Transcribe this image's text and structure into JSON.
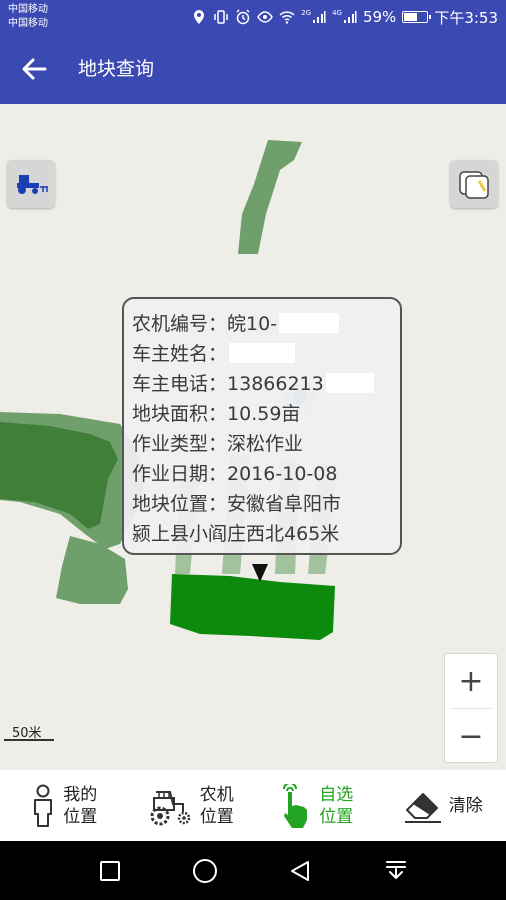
{
  "status_bar": {
    "carrier1": "中国移动",
    "carrier2": "中国移动",
    "net1": "2G",
    "net2": "4G",
    "battery": "59%",
    "battery_level": 0.59,
    "time": "下午3:53"
  },
  "app_bar": {
    "title": "地块查询",
    "back_icon": "arrow-left-icon",
    "bg_color": "#3b49b3"
  },
  "map": {
    "machine_icon": "tractor-icon",
    "layer_icon": "map-layer-icon",
    "zoom_in_label": "+",
    "zoom_out_label": "−",
    "scale_label": "50米",
    "parcel_color_light": "#6f9f6a",
    "parcel_color_dark": "#3f7f3a",
    "parcel_color_selected": "#0c8a0c"
  },
  "info_popup": {
    "rows": [
      {
        "key": "农机编号：",
        "value": "皖10-"
      },
      {
        "key": "车主姓名：",
        "value": ""
      },
      {
        "key": "车主电话：",
        "value": "13866213"
      },
      {
        "key": "地块面积：",
        "value": "10.59亩"
      },
      {
        "key": "作业类型：",
        "value": "深松作业"
      },
      {
        "key": "作业日期：",
        "value": "2016-10-08"
      },
      {
        "key": "地块位置：",
        "value": "安徽省阜阳市"
      }
    ],
    "address_cont": "颍上县小阎庄西北465米"
  },
  "toolbar": {
    "items": [
      {
        "line1": "我的",
        "line2": "位置",
        "icon": "person-icon"
      },
      {
        "line1": "农机",
        "line2": "位置",
        "icon": "tractor-icon"
      },
      {
        "line1": "自选",
        "line2": "位置",
        "icon": "tap-hand-icon"
      },
      {
        "line1": "清除",
        "icon": "eraser-icon"
      }
    ],
    "active_color": "#22a322"
  },
  "nav_bar": {
    "recent_icon": "square-icon",
    "home_icon": "circle-icon",
    "back_icon": "triangle-back-icon",
    "notif_icon": "pull-down-icon"
  }
}
